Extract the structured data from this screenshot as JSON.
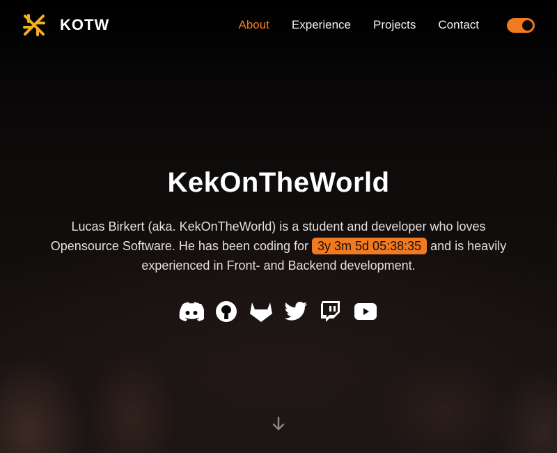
{
  "header": {
    "brand": "KOTW",
    "nav": [
      {
        "label": "About",
        "active": true
      },
      {
        "label": "Experience"
      },
      {
        "label": "Projects"
      },
      {
        "label": "Contact"
      }
    ],
    "theme_toggle": "on"
  },
  "hero": {
    "title": "KekOnTheWorld",
    "bio_before": "Lucas Birkert (aka. KekOnTheWorld) is a student and developer who loves Opensource Software. He has been coding for ",
    "coding_time": "3y 3m 5d 05:38:35",
    "bio_after": " and is heavily experienced in Front- and Backend development.",
    "socials": [
      "discord-icon",
      "github-icon",
      "gitlab-icon",
      "twitter-icon",
      "twitch-icon",
      "youtube-icon"
    ]
  },
  "colors": {
    "accent": "#f07a22",
    "background": "#0b0808"
  }
}
